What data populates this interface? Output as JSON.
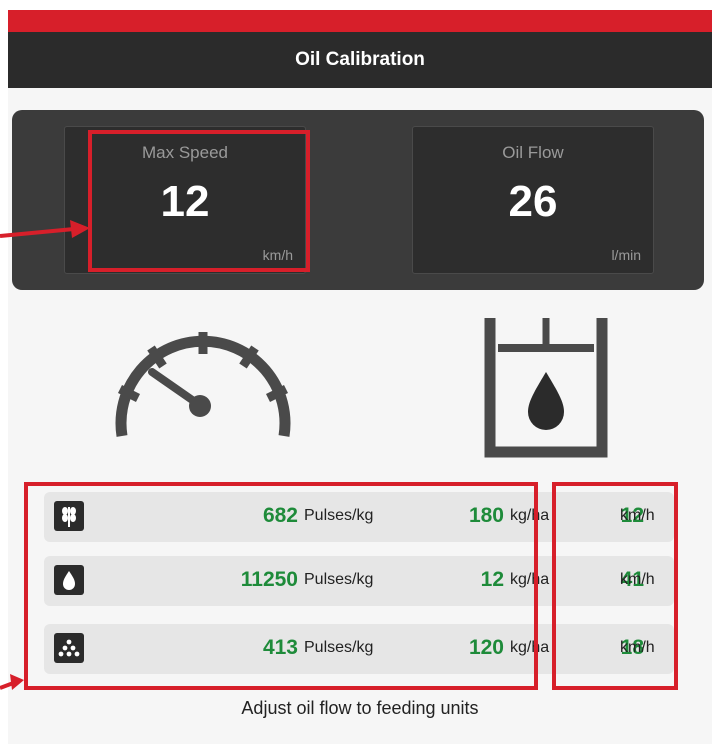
{
  "header": {
    "title": "Oil Calibration"
  },
  "tiles": {
    "max_speed": {
      "label": "Max Speed",
      "value": "12",
      "unit": "km/h"
    },
    "oil_flow": {
      "label": "Oil Flow",
      "value": "26",
      "unit": "l/min"
    }
  },
  "icons": {
    "speedometer": "speedometer-icon",
    "oil_tank": "oil-tank-icon"
  },
  "rows": [
    {
      "icon": "grain-icon",
      "pulses": "682",
      "pulses_unit": "Pulses/kg",
      "rate": "180",
      "rate_unit": "kg/ha",
      "speed": "12",
      "speed_unit": "km/h"
    },
    {
      "icon": "seed-drop-icon",
      "pulses": "11250",
      "pulses_unit": "Pulses/kg",
      "rate": "12",
      "rate_unit": "kg/ha",
      "speed": "41",
      "speed_unit": "km/h"
    },
    {
      "icon": "granules-icon",
      "pulses": "413",
      "pulses_unit": "Pulses/kg",
      "rate": "120",
      "rate_unit": "kg/ha",
      "speed": "18",
      "speed_unit": "km/h"
    }
  ],
  "footer": {
    "text": "Adjust oil flow to feeding units"
  },
  "colors": {
    "accent_red": "#d71f2a",
    "value_green": "#1e8b3a",
    "dark_panel": "#3b3b3b"
  }
}
